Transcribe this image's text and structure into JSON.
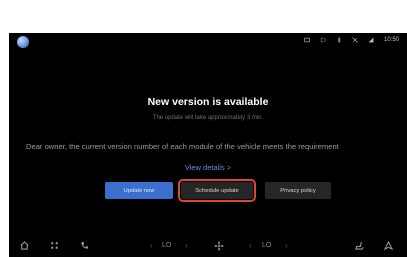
{
  "status": {
    "time": "10:50"
  },
  "dialog": {
    "title": "New version is available",
    "subtitle": "The update will take approximately 3 min.",
    "message": "Dear owner, the current version number of each module of the vehicle meets the requirement",
    "details_link": "View details >"
  },
  "buttons": {
    "update_now": "Update now",
    "schedule_update": "Schedule update",
    "privacy_policy": "Privacy policy"
  },
  "dock": {
    "left_temp": "LO",
    "right_temp": "LO"
  },
  "colors": {
    "accent": "#3a6fce",
    "highlight": "#d84a2c",
    "link": "#5f8ce0"
  }
}
